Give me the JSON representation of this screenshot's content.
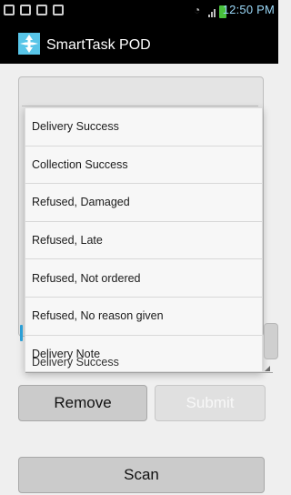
{
  "status": {
    "time": "12:50 PM",
    "notification_icons": [
      "image-icon",
      "mail-icon",
      "bag-icon",
      "bag-icon"
    ],
    "status_icons": [
      "wifi-icon",
      "signal-icon",
      "battery-icon"
    ]
  },
  "app": {
    "title": "SmartTask POD",
    "icon": "app-cross-icon",
    "accent_color": "#2b9fd6",
    "button_color": "#cbcbcb"
  },
  "menu": {
    "items": [
      "Delivery Success",
      "Collection Success",
      "Refused, Damaged",
      "Refused, Late",
      "Refused, Not ordered",
      "Refused, No reason given",
      "Delivery Note"
    ]
  },
  "dropdown": {
    "value": "Delivery Success",
    "icon": "dropdown-corner-arrow-icon"
  },
  "buttons": {
    "remove": "Remove",
    "submit": "Submit",
    "scan": "Scan"
  }
}
